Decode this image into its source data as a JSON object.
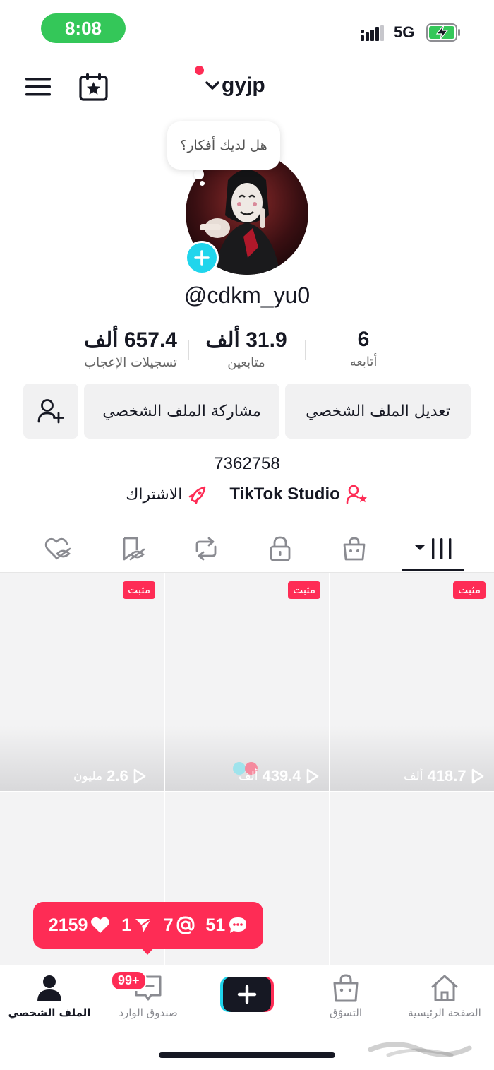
{
  "status_bar": {
    "time": "8:08",
    "network": "5G"
  },
  "header": {
    "username": "gyjp"
  },
  "profile": {
    "note_bubble": "هل لديك أفكار؟",
    "handle": "@cdkm_yu0",
    "stats": [
      {
        "value": "6",
        "label": "أتابعه"
      },
      {
        "value": "31.9 ألف",
        "label": "متابعين"
      },
      {
        "value": "657.4 ألف",
        "label": "تسجيلات الإعجاب"
      }
    ],
    "buttons": {
      "edit": "تعديل الملف الشخصي",
      "share": "مشاركة الملف الشخصي"
    },
    "bio": "7362758",
    "links": {
      "studio": "TikTok Studio",
      "subscription": "الاشتراك"
    }
  },
  "tabs": [
    {
      "name": "videos-grid",
      "icon": "grid-icon",
      "active": true
    },
    {
      "name": "shop",
      "icon": "shop-bag-icon"
    },
    {
      "name": "private",
      "icon": "lock-icon"
    },
    {
      "name": "reposts",
      "icon": "repost-icon"
    },
    {
      "name": "favorites",
      "icon": "bookmark-hidden-icon"
    },
    {
      "name": "liked",
      "icon": "heart-hidden-icon"
    }
  ],
  "videos": [
    {
      "pinned": "مثبت",
      "views": "418.7",
      "unit": "ألف"
    },
    {
      "pinned": "مثبت",
      "views": "439.4",
      "unit": "ألف"
    },
    {
      "pinned": "مثبت",
      "views": "2.6",
      "unit": "مليون"
    }
  ],
  "notifications": {
    "comments": "51",
    "mentions": "7",
    "shares": "1",
    "likes": "2159"
  },
  "bottom_nav": {
    "home": "الصفحة الرئيسية",
    "shop": "التسوّق",
    "inbox": "صندوق الوارد",
    "inbox_badge": "99+",
    "profile": "الملف الشخصي"
  },
  "colors": {
    "accent": "#fe2c55",
    "cyan": "#20d5ec",
    "status_green": "#34c759"
  }
}
